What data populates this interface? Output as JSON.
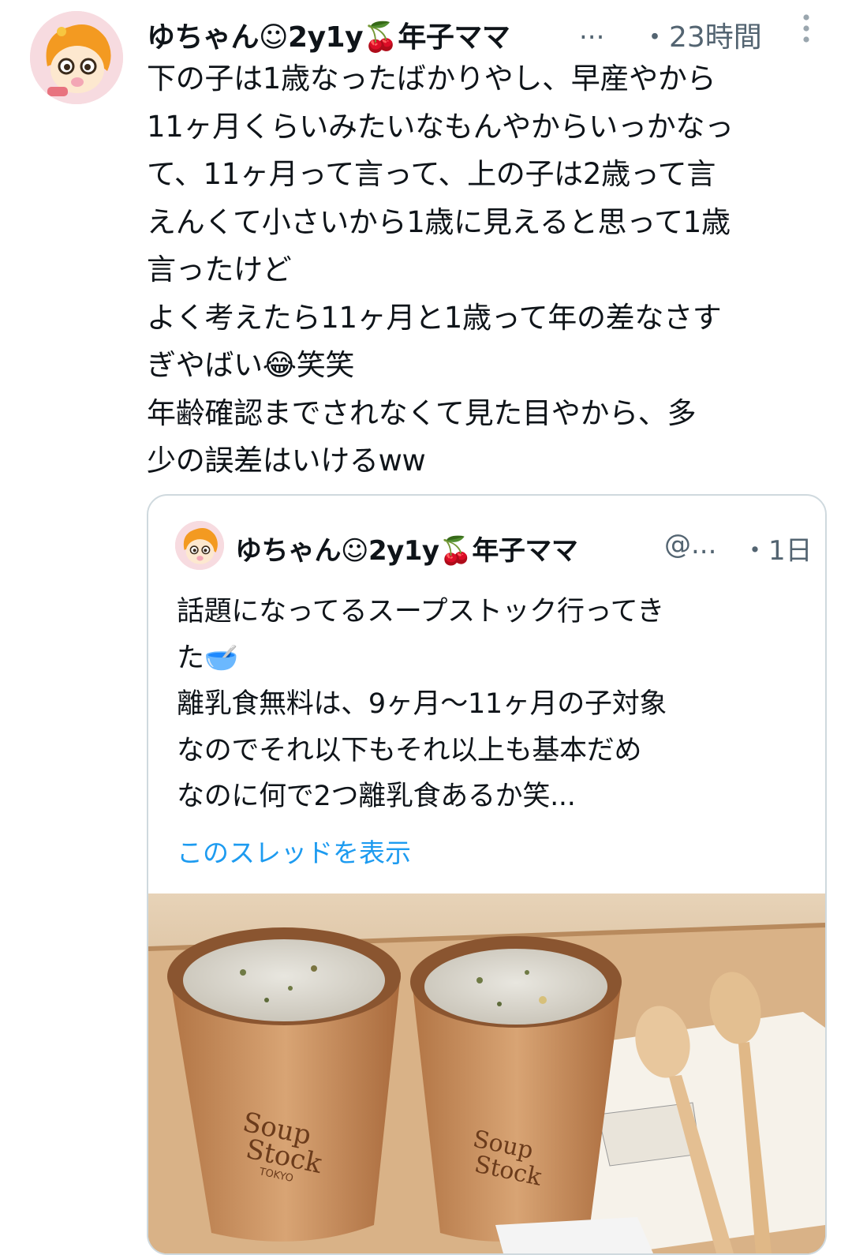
{
  "tweet": {
    "display_name": "ゆちゃん☺2y1y🍒年子ママ",
    "truncation": "...",
    "timestamp": "・23時間",
    "body": "下の子は1歳なったばかりやし、早産やから\n11ヶ月くらいみたいなもんやからいっかなっ\nて、11ヶ月って言って、上の子は2歳って言\nえんくて小さいから1歳に見えると思って1歳\n言ったけど\nよく考えたら11ヶ月と1歳って年の差なさす\nぎやばい😂笑笑\n年齢確認までされなくて見た目やから、多\n少の誤差はいけるww"
  },
  "quoted": {
    "display_name": "ゆちゃん☺2y1y🍒年子ママ",
    "handle": "@...",
    "timestamp": "・1日",
    "body": "話題になってるスープストック行ってき\nた🥣\n離乳食無料は、9ヶ月〜11ヶ月の子対象\nなのでそれ以下もそれ以上も基本だめ\nなのに何で2つ離乳食あるか笑...",
    "thread_link": "このスレッドを表示",
    "media": {
      "cup_brand_line1": "Soup",
      "cup_brand_line2": "Stock",
      "cup_brand_line3": "TOKYO"
    }
  },
  "icons": [
    "avatar-illustration",
    "more-vertical-icon"
  ],
  "colors": {
    "link": "#1d9bf0",
    "secondary_text": "#536471",
    "border": "#cfd9de"
  }
}
